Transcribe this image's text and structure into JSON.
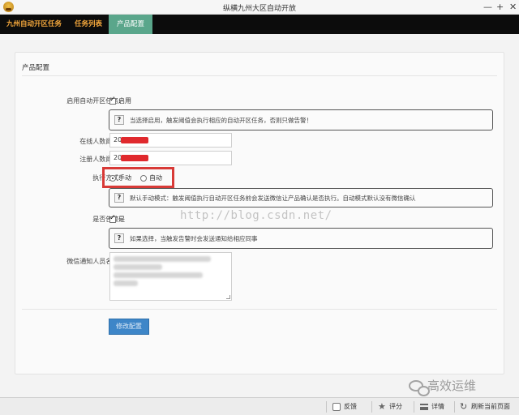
{
  "window": {
    "title": "纵横九州大区自动开放",
    "minimize": "—",
    "maximize": "+",
    "close": "✕"
  },
  "nav": {
    "tabs": [
      {
        "label": "九州自动开区任务"
      },
      {
        "label": "任务列表"
      },
      {
        "label": "产品配置",
        "active": true
      }
    ]
  },
  "panel": {
    "title": "产品配置",
    "enable_label": "启用自动开区任务:",
    "enable_option": "启用",
    "enable_checked": true,
    "enable_hint": "当选择启用，触发阈值会执行相应的自动开区任务，否则只做告警！",
    "online_label": "在线人数阈值:",
    "online_value": "20",
    "register_label": "注册人数阈值:",
    "register_value": "20",
    "mode_label": "执行方式:",
    "mode_manual": "手动",
    "mode_auto": "自动",
    "mode_selected": "手动",
    "mode_hint": "默认手动模式：触发阈值执行自动开区任务前会发送微信让产品确认是否执行。自动模式默认没有微信确认",
    "alert_label": "是否告警:",
    "alert_option": "是",
    "alert_checked": true,
    "alert_hint": "如果选择，当触发告警时会发送通知给相应同事",
    "wechat_label": "微信通知人员名单:",
    "save_button": "修改配置"
  },
  "watermark": {
    "url": "http://blog.csdn.net/",
    "brand": "高效运维"
  },
  "statusbar": {
    "feedback": "反馈",
    "rate": "评分",
    "details": "详情",
    "refresh": "刷新当前页面"
  },
  "colors": {
    "nav_bg": "#0c0c0c",
    "nav_text": "#f3a73c",
    "nav_active_bg": "#5aa68b",
    "button_bg": "#3e86c8",
    "highlight_border": "#d83a37",
    "redaction": "#e0292d"
  },
  "icons": [
    "app-logo-icon",
    "question-icon",
    "feedback-icon",
    "star-icon",
    "list-icon",
    "refresh-icon",
    "wechat-icon"
  ]
}
